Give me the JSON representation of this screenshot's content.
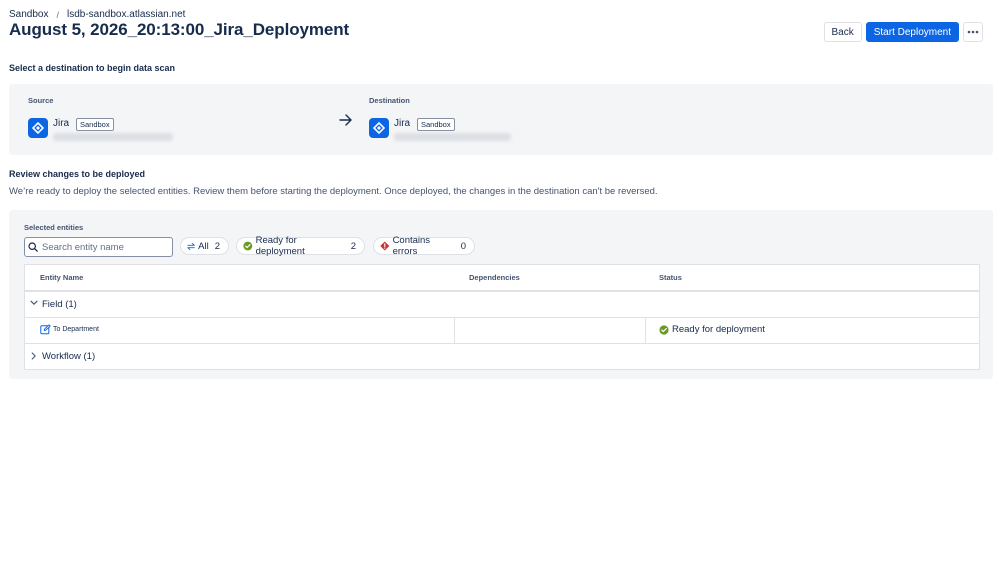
{
  "breadcrumb": {
    "items": [
      "Sandbox",
      "lsdb-sandbox.atlassian.net"
    ],
    "separator": "/"
  },
  "page_title": "August 5, 2026_20:13:00_Jira_Deployment",
  "actions": {
    "back": "Back",
    "start": "Start Deployment",
    "more_icon": "more-horizontal-icon"
  },
  "destination_section": {
    "heading": "Select a destination to begin data scan",
    "source": {
      "label": "Source",
      "app": "Jira",
      "tag": "Sandbox",
      "icon": "jira-icon"
    },
    "destination": {
      "label": "Destination",
      "app": "Jira",
      "tag": "Sandbox",
      "icon": "jira-icon"
    },
    "arrow_icon": "arrow-right-icon"
  },
  "review_section": {
    "heading": "Review changes to be deployed",
    "description": "We’re ready to deploy the selected entities. Review them before starting the deployment. Once deployed, the changes in the destination can't be reversed."
  },
  "entities": {
    "label": "Selected entities",
    "search": {
      "placeholder": "Search entity name",
      "value": ""
    },
    "filters": [
      {
        "label": "All",
        "count": "2",
        "icon": "swap-icon"
      },
      {
        "label": "Ready for deployment",
        "count": "2",
        "icon": "check-circle-icon"
      },
      {
        "label": "Contains errors",
        "count": "0",
        "icon": "error-icon"
      }
    ],
    "columns": [
      "Entity Name",
      "Dependencies",
      "Status"
    ],
    "groups": [
      {
        "label": "Field (1)",
        "expanded": true,
        "rows": [
          {
            "name": "To Department",
            "icon": "edit-icon",
            "dependencies": "",
            "status": "Ready for deployment"
          }
        ]
      },
      {
        "label": "Workflow (1)",
        "expanded": false,
        "rows": []
      }
    ]
  },
  "colors": {
    "primary": "#0c66e4",
    "success": "#6a9a23",
    "danger": "#c9372c",
    "panel": "#f4f5f7"
  }
}
